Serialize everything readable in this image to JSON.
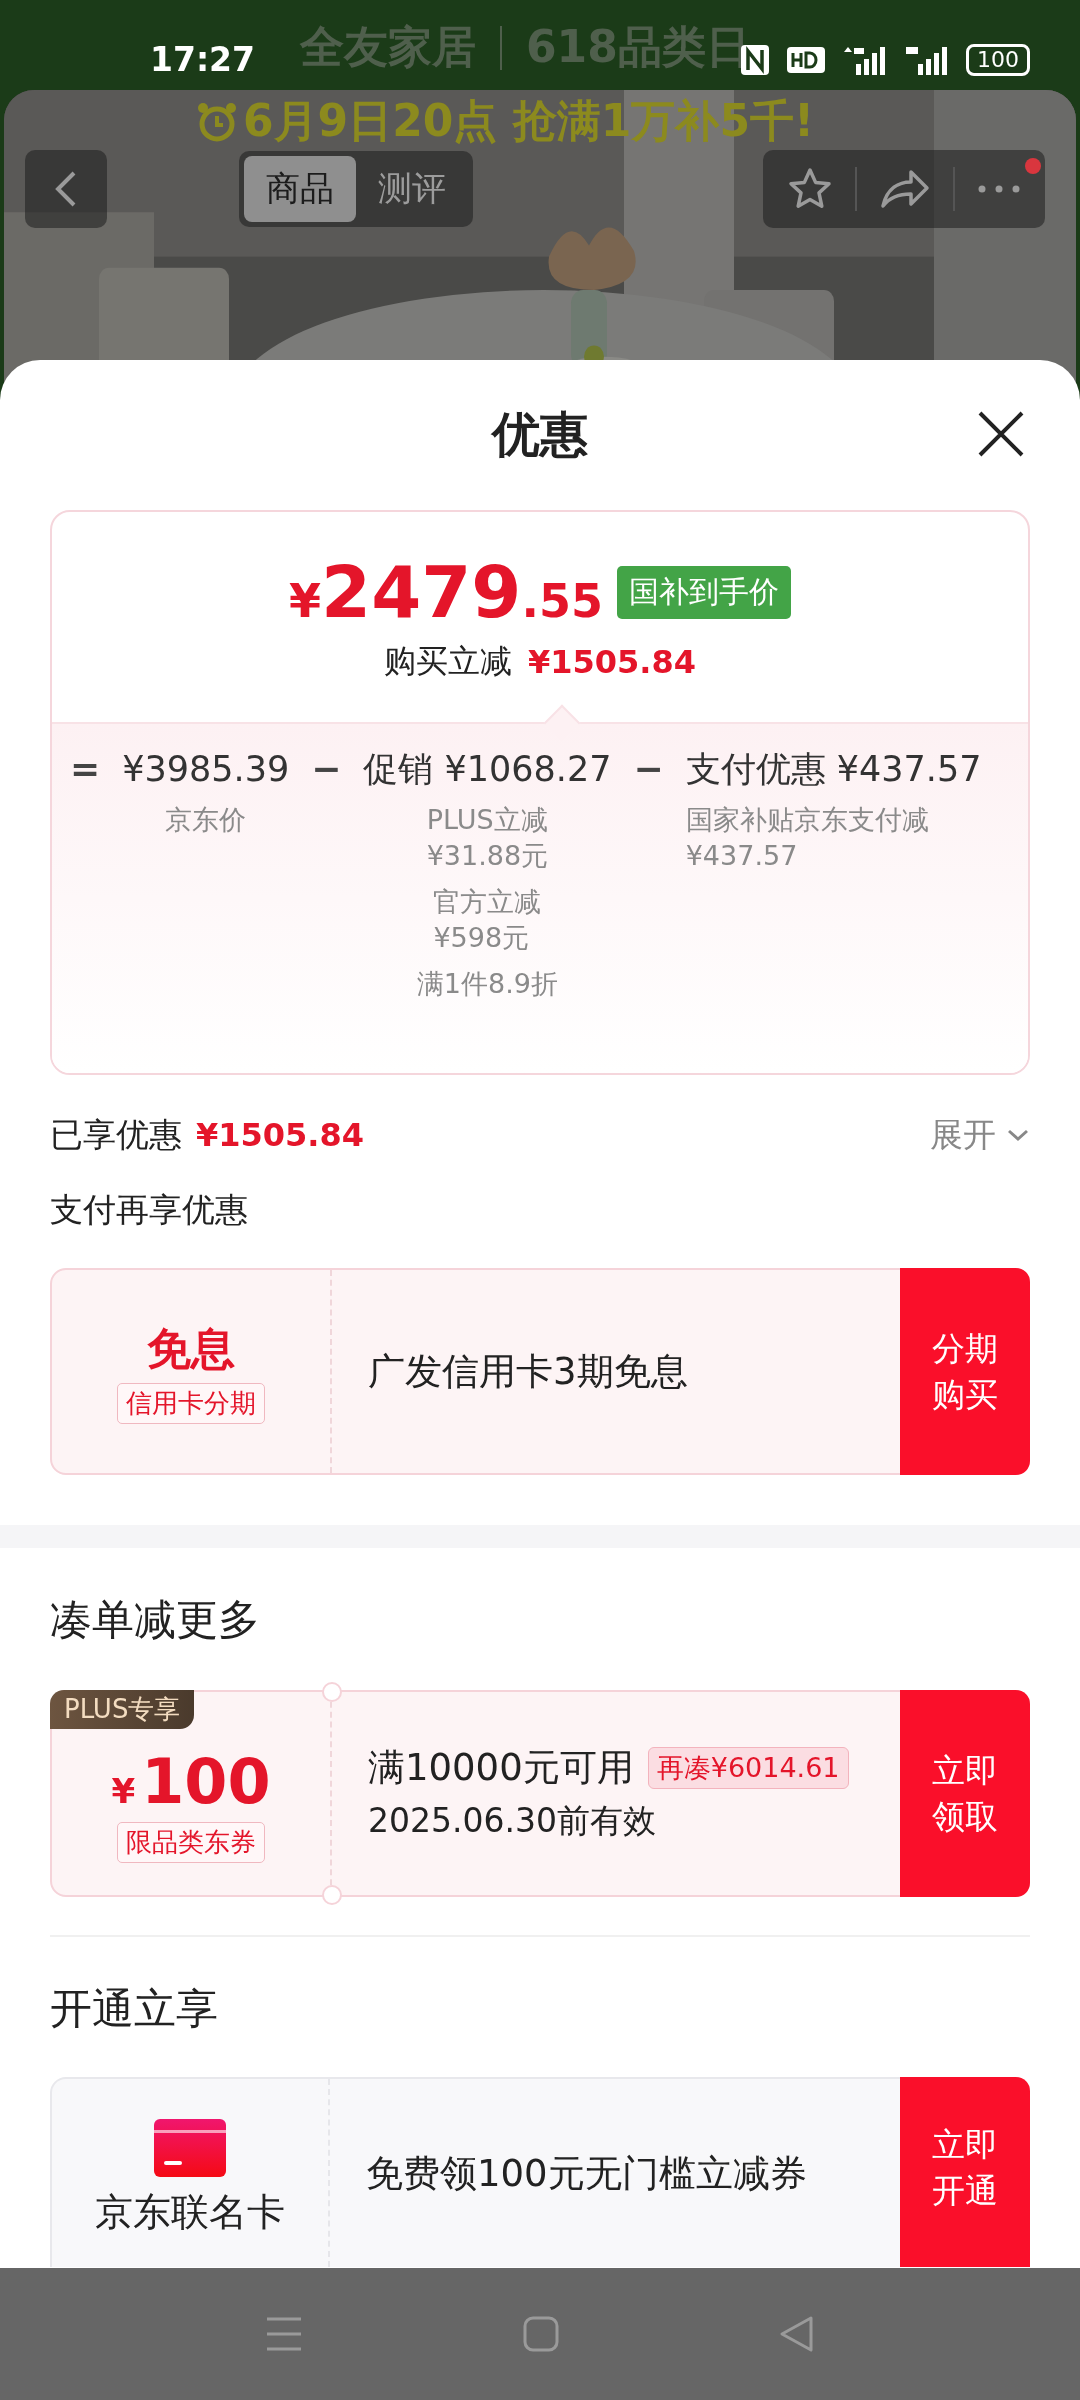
{
  "status_bar": {
    "time": "17:27",
    "battery": "100"
  },
  "page_header": {
    "brand": "全友家居",
    "event": "618品类日"
  },
  "banner": {
    "text": "6月9日20点 抢满1万补5千!"
  },
  "nav": {
    "tabs": [
      {
        "label": "商品",
        "selected": true
      },
      {
        "label": "测评",
        "selected": false
      }
    ],
    "has_notification": true
  },
  "sheet": {
    "title": "优惠"
  },
  "price_card": {
    "currency": "¥",
    "integer": "2479",
    "decimal": ".55",
    "tag": "国补到手价",
    "saving_label": "购买立减",
    "saving": "¥1505.84",
    "breakdown": [
      {
        "operator": "=",
        "heading": "¥3985.39",
        "notes": [
          [
            "京东价"
          ]
        ]
      },
      {
        "operator": "−",
        "heading": "促销 ¥1068.27",
        "notes": [
          [
            "PLUS立减",
            "¥31.88元"
          ],
          [
            "官方立减",
            "¥598元"
          ],
          [
            "满1件8.9折"
          ]
        ]
      },
      {
        "operator": "−",
        "heading": "支付优惠 ¥437.57",
        "notes": [
          [
            "国家补贴京东支付减",
            "¥437.57"
          ]
        ]
      }
    ]
  },
  "enjoyed": {
    "label": "已享优惠",
    "amount": "¥1505.84",
    "toggle": "展开"
  },
  "pay_section": {
    "title": "支付再享优惠",
    "card": {
      "badge_title": "免息",
      "badge_sub": "信用卡分期",
      "text": "广发信用卡3期免息",
      "action": "分期购买"
    }
  },
  "bundle_section": {
    "title": "凑单减更多",
    "coupon": {
      "tag": "PLUS专享",
      "currency": "¥",
      "amount": "100",
      "sub": "限品类东券",
      "condition": "满10000元可用",
      "extra": "再凑¥6014.61",
      "validity": "2025.06.30前有效",
      "action": "立即领取"
    }
  },
  "open_section": {
    "title": "开通立享",
    "card": {
      "name": "京东联名卡",
      "text": "免费领100元无门槛立减券",
      "action": "立即开通"
    }
  }
}
